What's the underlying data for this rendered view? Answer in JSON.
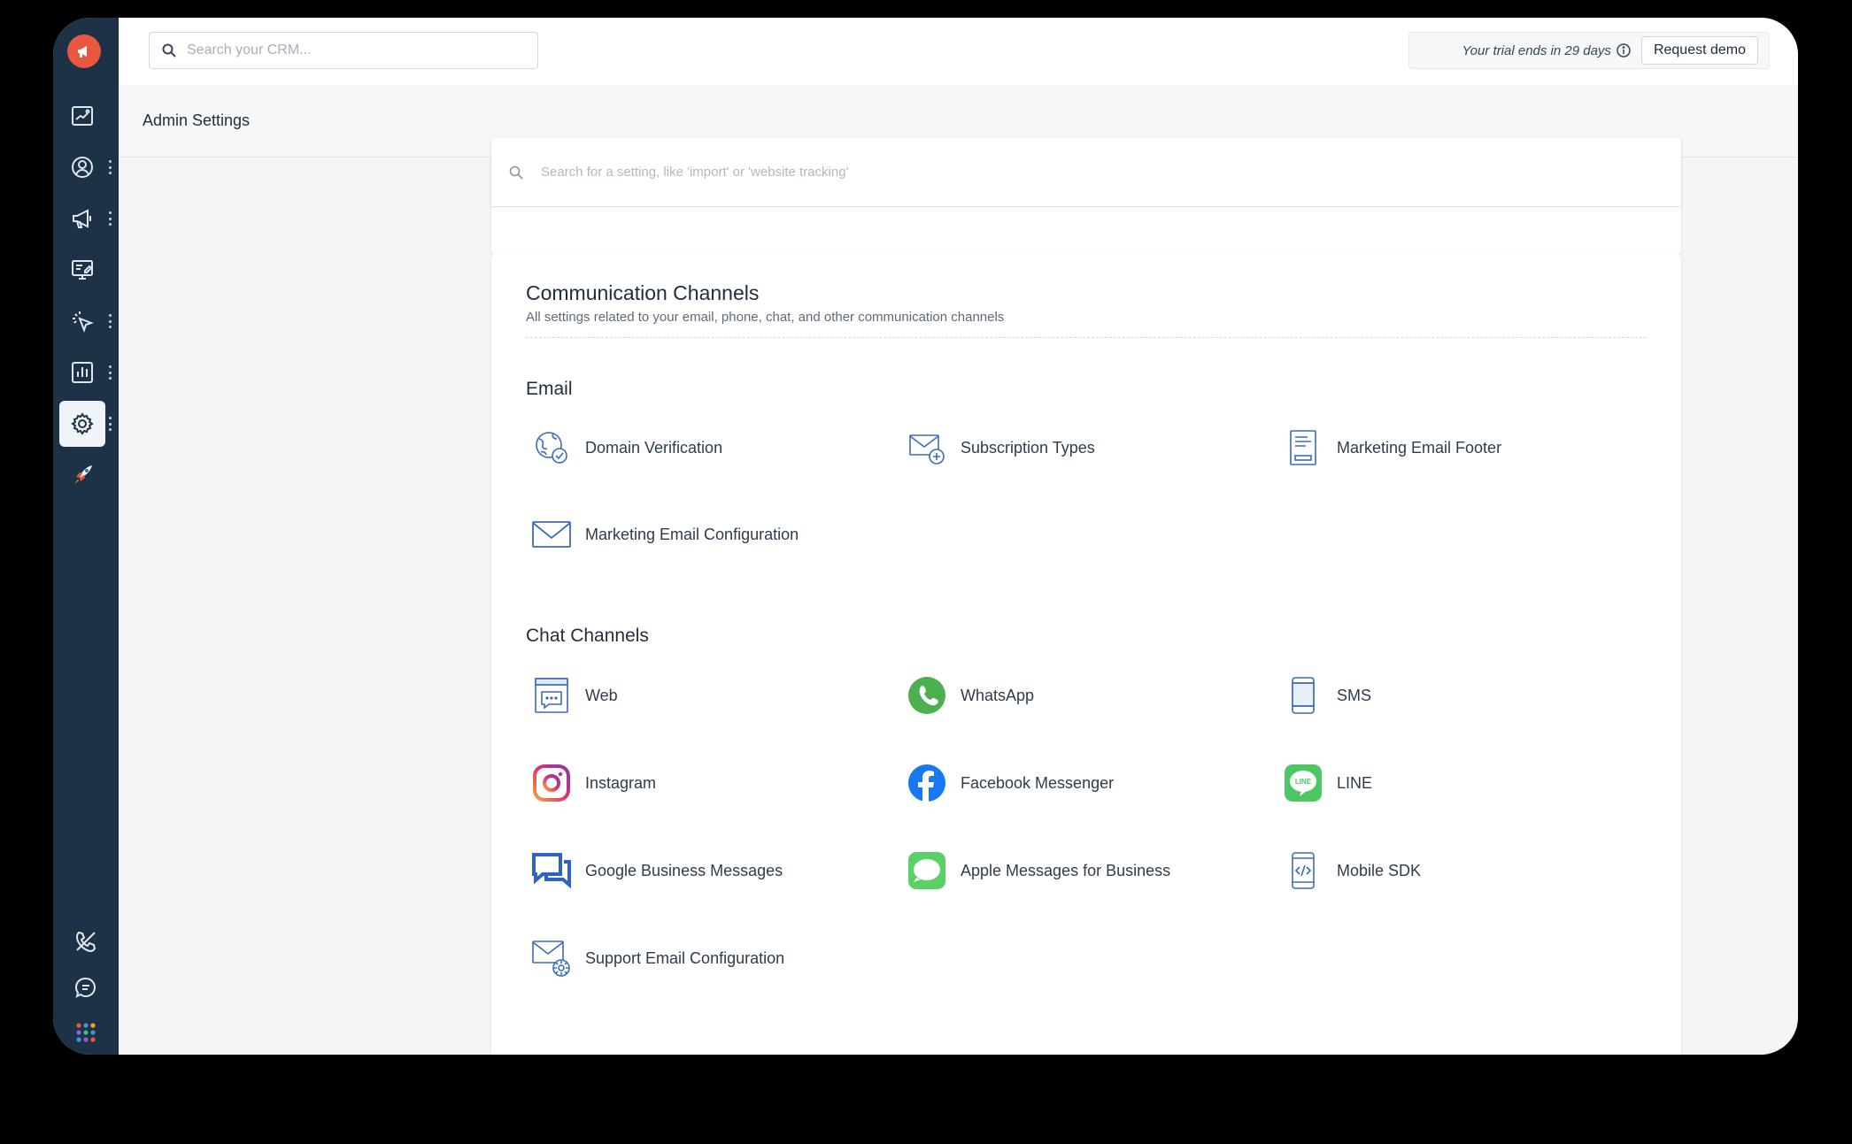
{
  "topbar": {
    "search_placeholder": "Search your CRM...",
    "trial_text": "Your trial ends in 29 days",
    "request_demo": "Request demo"
  },
  "header": {
    "title": "Admin Settings"
  },
  "settings_search": {
    "placeholder": "Search for a setting, like 'import' or 'website tracking'"
  },
  "section": {
    "title": "Communication Channels",
    "subtitle": "All settings related to your email, phone, chat, and other communication channels"
  },
  "email": {
    "heading": "Email",
    "items": [
      {
        "label": "Domain Verification",
        "icon": "domain-verification-icon"
      },
      {
        "label": "Subscription Types",
        "icon": "subscription-types-icon"
      },
      {
        "label": "Marketing Email Footer",
        "icon": "email-footer-icon"
      },
      {
        "label": "Marketing Email Configuration",
        "icon": "envelope-icon"
      }
    ]
  },
  "chat": {
    "heading": "Chat Channels",
    "items": [
      {
        "label": "Web",
        "icon": "web-chat-icon"
      },
      {
        "label": "WhatsApp",
        "icon": "whatsapp-icon"
      },
      {
        "label": "SMS",
        "icon": "sms-phone-icon"
      },
      {
        "label": "Instagram",
        "icon": "instagram-icon"
      },
      {
        "label": "Facebook Messenger",
        "icon": "facebook-icon"
      },
      {
        "label": "LINE",
        "icon": "line-icon"
      },
      {
        "label": "Google Business Messages",
        "icon": "google-business-messages-icon"
      },
      {
        "label": "Apple Messages for Business",
        "icon": "apple-messages-icon"
      },
      {
        "label": "Mobile SDK",
        "icon": "mobile-sdk-icon"
      },
      {
        "label": "Support Email Configuration",
        "icon": "support-email-config-icon"
      }
    ]
  },
  "icons": {
    "line_badge": "LINE"
  },
  "colors": {
    "sidebar": "#1d3147",
    "brand": "#e9573f",
    "whatsapp": "#4caf50",
    "facebook": "#1877f2",
    "line": "#4cc764",
    "apple_messages": "#5bd065",
    "outline_icons": "#3a6bbf"
  }
}
